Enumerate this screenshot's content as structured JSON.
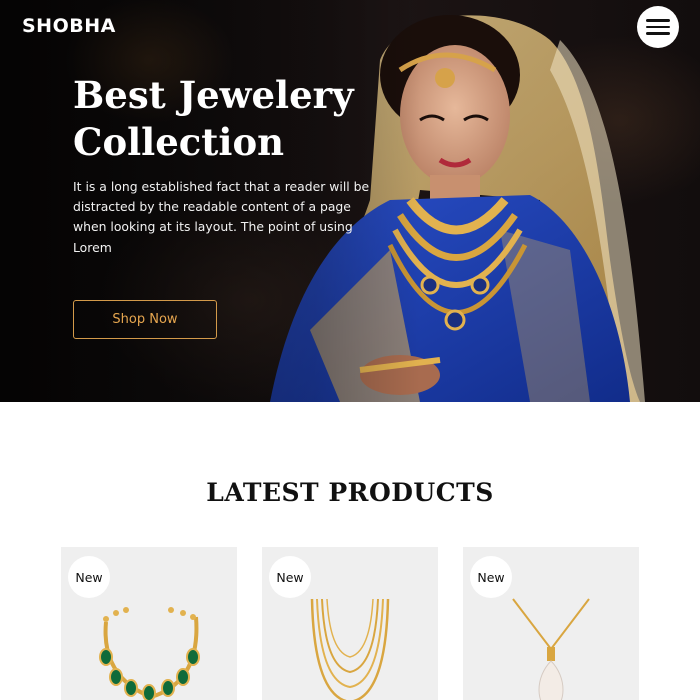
{
  "header": {
    "brand": "SHOBHA",
    "menu_icon": "hamburger-menu-icon"
  },
  "hero": {
    "title": "Best Jewelery Collection",
    "text": "It is a long established fact that a reader will be distracted by the readable content of a page when looking at its layout. The point of using Lorem",
    "cta_label": "Shop Now"
  },
  "products": {
    "heading": "LATEST PRODUCTS",
    "items": [
      {
        "badge": "New",
        "art": "emerald-bracelet-image"
      },
      {
        "badge": "New",
        "art": "gold-layered-necklace-image"
      },
      {
        "badge": "New",
        "art": "pearl-pendant-necklace-image"
      }
    ]
  },
  "colors": {
    "accent": "#d39a4a",
    "hero_bg": "#151010",
    "card_bg": "#efefef"
  }
}
